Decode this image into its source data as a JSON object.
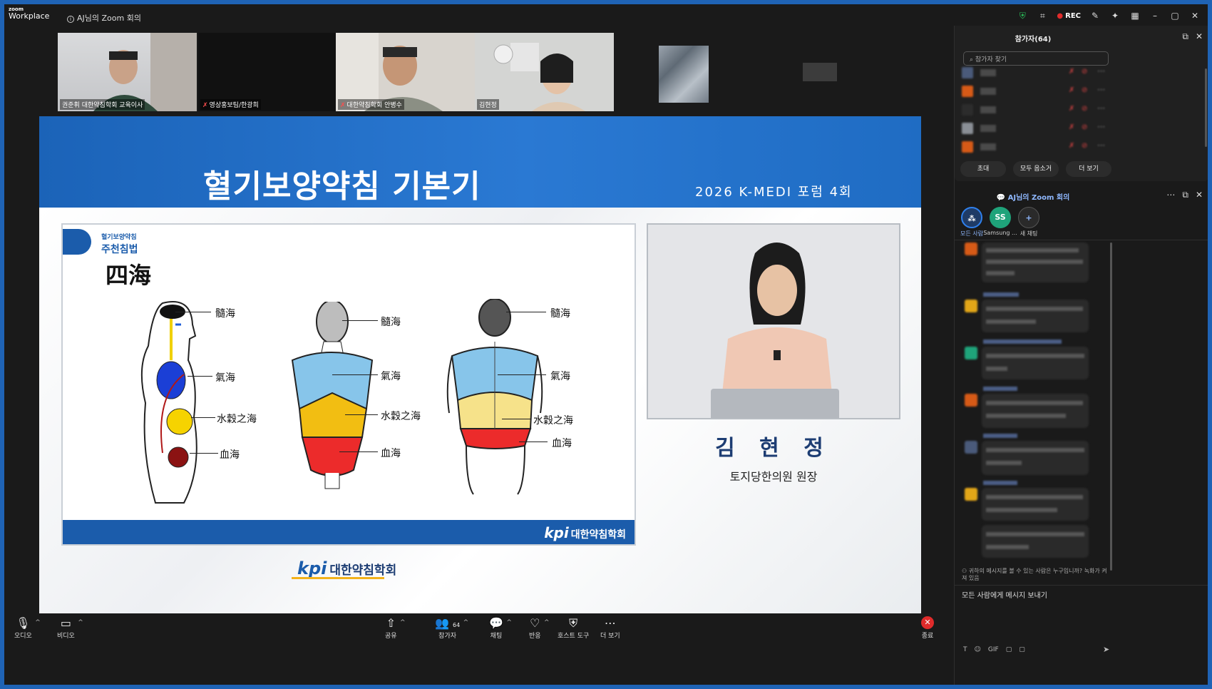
{
  "window": {
    "app_logo_top": "zoom",
    "app_logo_bottom": "Workplace",
    "meeting_title": "AJ님의 Zoom 회의",
    "rec_label": "REC"
  },
  "thumbnails": [
    {
      "name": "권준휘 대한약침학회 교육이사",
      "muted": false
    },
    {
      "name": "영상홍보팀/한광희",
      "muted": true
    },
    {
      "name": "대한약침학회 안병수",
      "muted": true
    },
    {
      "name": "김현정",
      "muted": false
    }
  ],
  "slide": {
    "title": "혈기보양약침 기본기",
    "forum": "2026 K-MEDI 포럼 4회",
    "inner": {
      "category": "혈기보양약침",
      "subtitle": "주천침법",
      "heading": "四海",
      "footer_logo_kpi": "kpi",
      "footer_logo_text": "대한약침학회",
      "figures": [
        {
          "labels": [
            "髓海",
            "氣海",
            "水穀之海",
            "血海"
          ]
        },
        {
          "labels": [
            "髓海",
            "氣海",
            "水穀之海",
            "血海"
          ]
        },
        {
          "labels": [
            "髓海",
            "氣海",
            "水穀之海",
            "血海"
          ]
        }
      ]
    },
    "speaker_name": "김 현 정",
    "speaker_role": "토지당한의원 원장",
    "bottom_logo_kpi": "kpi",
    "bottom_logo_text": "대한약침학회"
  },
  "toolbar": {
    "audio": "오디오",
    "video": "비디오",
    "share": "공유",
    "participants": "참가자",
    "participants_count": "64",
    "chat": "채팅",
    "react": "반응",
    "host_tools": "호스트 도구",
    "more": "더 보기",
    "end": "종료"
  },
  "participants_panel": {
    "title": "참가자(64)",
    "search_placeholder": "참가자 찾기",
    "invite": "초대",
    "mute_all": "모두 음소거",
    "more": "더 보기"
  },
  "chat_panel": {
    "title": "AJ님의 Zoom 회의",
    "tabs": [
      {
        "label": "모든 사람",
        "initials": ""
      },
      {
        "label": "Samsung ...",
        "initials": "SS"
      },
      {
        "label": "새 채팅",
        "initials": "+"
      }
    ],
    "notice": "귀하의 메시지를 볼 수 있는 사람은 누구입니까? 녹화가 켜져 있음",
    "input_placeholder": "모든 사람에게 메시지 보내기",
    "tools": [
      "T",
      "☺",
      "GIF",
      "▢",
      "▢"
    ]
  },
  "colors": {
    "accent": "#2f80ed",
    "banner_blue": "#1f6cc3",
    "rec_red": "#e02b2b",
    "end_red": "#e02b2b"
  }
}
